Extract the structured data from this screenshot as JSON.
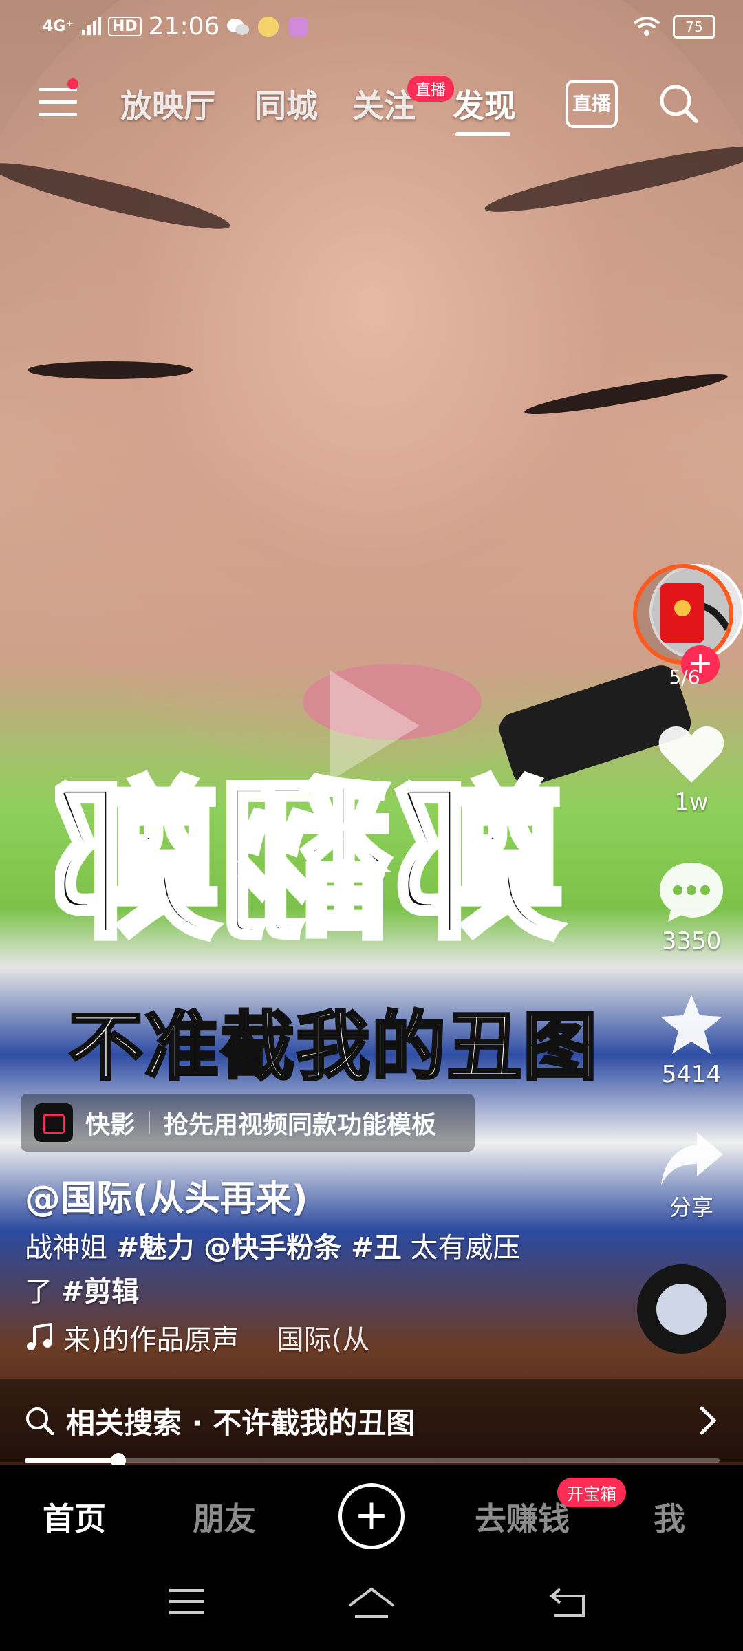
{
  "status_bar": {
    "network": "4G⁺",
    "hd": "HD",
    "time": "21:06",
    "battery": "75"
  },
  "top_nav": {
    "tabs": [
      {
        "label": "放映厅"
      },
      {
        "label": "同城"
      },
      {
        "label": "关注"
      },
      {
        "label": "发现"
      }
    ],
    "active_tab": "发现",
    "follow_badge": "直播",
    "live_label": "直播"
  },
  "video": {
    "caption": "不准截我的丑图",
    "shirt_text": "鄭翻鄭"
  },
  "right_bar": {
    "redpack_progress": "5/6",
    "like_count": "1w",
    "comment_count": "3350",
    "star_count": "5414",
    "share_label": "分享"
  },
  "kuaiying": {
    "name": "快影",
    "text": "抢先用视频同款功能模板"
  },
  "author": "@国际(从头再来)",
  "description": {
    "part1": "战神姐 ",
    "tag1": "#魅力",
    "part2": " @快手粉条 ",
    "tag2": "#丑",
    "part3": " 太有威压",
    "part4": "了 ",
    "tag3": "#剪辑"
  },
  "music": {
    "text1": "来)的作品原声",
    "text2": "国际(从"
  },
  "related_search": {
    "label": "相关搜索 · 不许截我的丑图"
  },
  "progress": {
    "fraction": 0.135
  },
  "bottom_nav": {
    "home": "首页",
    "friends": "朋友",
    "earn": "去赚钱",
    "earn_badge": "开宝箱",
    "me": "我"
  },
  "colors": {
    "accent": "#fe2c55",
    "redpack_ring": "#ff5a1f"
  }
}
